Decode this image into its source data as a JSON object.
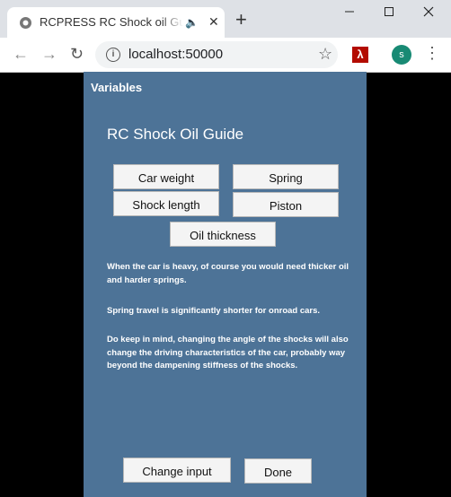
{
  "browser": {
    "tab_title": "RCPRESS RC Shock oil Guide",
    "url": "localhost:50000",
    "profile_initial": "s"
  },
  "app": {
    "section_label": "Variables",
    "title": "RC Shock Oil Guide",
    "buttons": {
      "car_weight": "Car weight",
      "spring": "Spring",
      "shock_length": "Shock length",
      "piston": "Piston",
      "oil_thickness": "Oil thickness",
      "change_input": "Change input",
      "done": "Done"
    },
    "messages": [
      "When the car is heavy, of course you would need thicker oil and harder springs.",
      "Spring travel is significantly shorter for onroad cars.",
      "Do keep in mind, changing the angle of the shocks will also change the driving characteristics of the car, probably way beyond the dampening stiffness of the shocks."
    ],
    "colors": {
      "panel_bg": "#4d7397",
      "page_bg": "#000000"
    }
  }
}
